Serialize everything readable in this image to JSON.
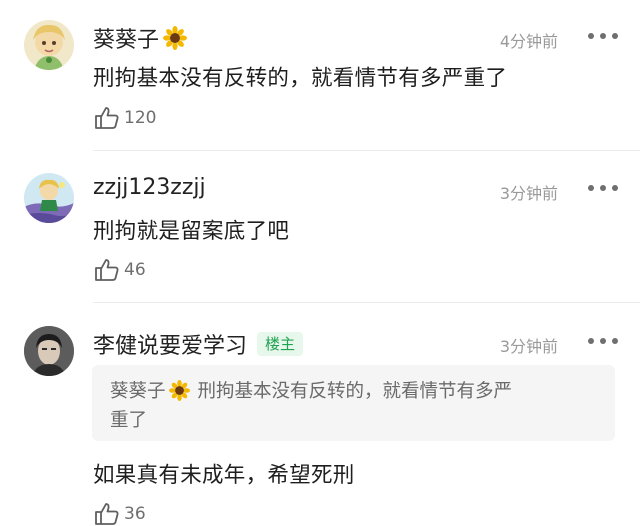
{
  "comments": [
    {
      "username": "葵葵子",
      "time": "4分钟前",
      "text": "刑拘基本没有反转的，就看情节有多严重了",
      "likes": "120"
    },
    {
      "username": "zzjj123zzjj",
      "time": "3分钟前",
      "text": "刑拘就是留案底了吧",
      "likes": "46"
    },
    {
      "username": "李健说要爱学习",
      "badge": "楼主",
      "time": "3分钟前",
      "quote": {
        "username": "葵葵子",
        "line1": "刑拘基本没有反转的，就看情节有多严",
        "line2": "重了"
      },
      "text": "如果真有未成年，希望死刑",
      "likes": "36"
    }
  ],
  "icons": {
    "flower": "sunflower-emoji",
    "more": "more-icon",
    "like": "thumbs-up-icon"
  },
  "colors": {
    "badge_text": "#1fa350",
    "badge_bg": "#e8f7ec",
    "meta_gray": "#9a9a9a"
  }
}
